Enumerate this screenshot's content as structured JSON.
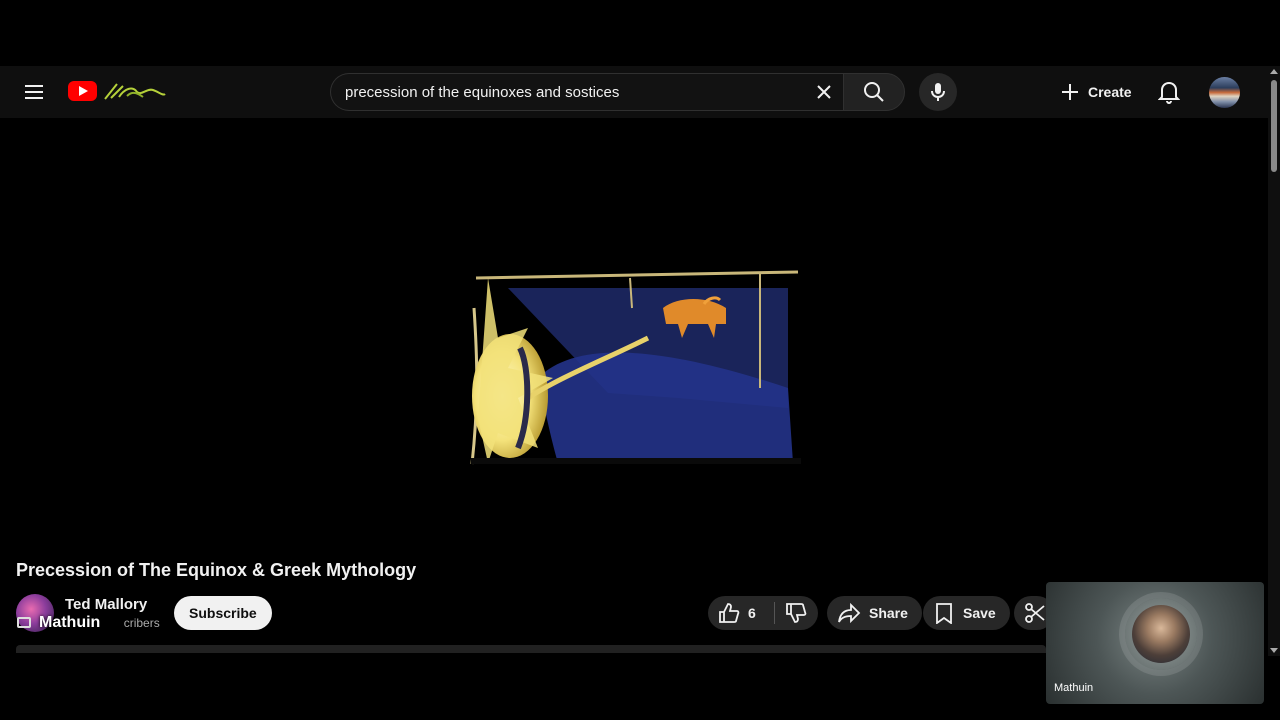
{
  "header": {
    "search_value": "precession of the equinoxes and sostices",
    "create_label": "Create"
  },
  "video": {
    "title": "Precession of The Equinox & Greek Mythology",
    "channel_name": "Ted Mallory",
    "subscribers_text": "cribers",
    "subscribe_label": "Subscribe",
    "overlay_name": "Mathuin"
  },
  "actions": {
    "like_count": "6",
    "share_label": "Share",
    "save_label": "Save"
  },
  "pip": {
    "participant_name": "Mathuin"
  },
  "colors": {
    "brand_red": "#ff0000",
    "background": "#0f0f0f",
    "pill": "#272727"
  },
  "icons": [
    "menu-icon",
    "youtube-logo-icon",
    "clear-icon",
    "search-icon",
    "mic-icon",
    "plus-icon",
    "bell-icon",
    "like-icon",
    "dislike-icon",
    "share-icon",
    "save-icon",
    "clip-icon",
    "screen-share-icon"
  ]
}
